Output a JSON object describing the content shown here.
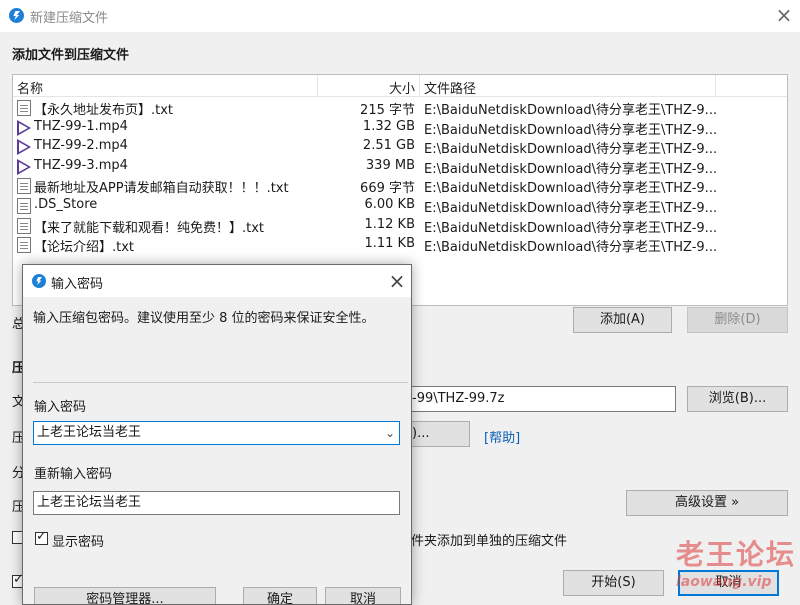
{
  "main_window": {
    "title": "新建压缩文件",
    "section_add": "添加文件到压缩文件",
    "columns": {
      "name": "名称",
      "size": "大小",
      "path": "文件路径"
    },
    "files": [
      {
        "icon": "doc",
        "name": "【永久地址发布页】.txt",
        "size": "215 字节",
        "path": "E:\\BaiduNetdiskDownload\\待分享老王\\THZ-9..."
      },
      {
        "icon": "video",
        "name": "THZ-99-1.mp4",
        "size": "1.32 GB",
        "path": "E:\\BaiduNetdiskDownload\\待分享老王\\THZ-9..."
      },
      {
        "icon": "video",
        "name": "THZ-99-2.mp4",
        "size": "2.51 GB",
        "path": "E:\\BaiduNetdiskDownload\\待分享老王\\THZ-9..."
      },
      {
        "icon": "video",
        "name": "THZ-99-3.mp4",
        "size": "339 MB",
        "path": "E:\\BaiduNetdiskDownload\\待分享老王\\THZ-9..."
      },
      {
        "icon": "doc",
        "name": "最新地址及APP请发邮箱自动获取！！！.txt",
        "size": "669 字节",
        "path": "E:\\BaiduNetdiskDownload\\待分享老王\\THZ-9..."
      },
      {
        "icon": "doc",
        "name": ".DS_Store",
        "size": "6.00 KB",
        "path": "E:\\BaiduNetdiskDownload\\待分享老王\\THZ-9..."
      },
      {
        "icon": "doc",
        "name": "【来了就能下载和观看！纯免费！】.txt",
        "size": "1.12 KB",
        "path": "E:\\BaiduNetdiskDownload\\待分享老王\\THZ-9..."
      },
      {
        "icon": "doc",
        "name": "【论坛介绍】.txt",
        "size": "1.11 KB",
        "path": "E:\\BaiduNetdiskDownload\\待分享老王\\THZ-9..."
      }
    ],
    "partial_total": "总",
    "btn_add": "添加(A)",
    "btn_delete": "删除(D)",
    "partial_section": "压",
    "partial_file": "文",
    "archive_path_visible": "-99\\THZ-99.7z",
    "btn_browse": "浏览(B)...",
    "partial_compress": "压",
    "partial_dropdown_btn": ")...",
    "help_link": "[帮助]",
    "partial_split": "分",
    "partial_compress2": "压",
    "btn_advanced": "高级设置 »",
    "separate_archives_text": "件夹添加到单独的压缩文件",
    "btn_start": "开始(S)",
    "btn_cancel": "取消",
    "watermark_main": "老王论坛",
    "watermark_sub": "laowang.vip"
  },
  "dialog": {
    "title": "输入密码",
    "description": "输入压缩包密码。建议使用至少 8 位的密码来保证安全性。",
    "label_password": "输入密码",
    "password_value": "上老王论坛当老王",
    "label_reenter": "重新输入密码",
    "reenter_value": "上老王论坛当老王",
    "show_password_label": "显示密码",
    "show_password_checked": true,
    "btn_manager": "密码管理器...",
    "btn_ok": "确定",
    "btn_cancel": "取消"
  }
}
